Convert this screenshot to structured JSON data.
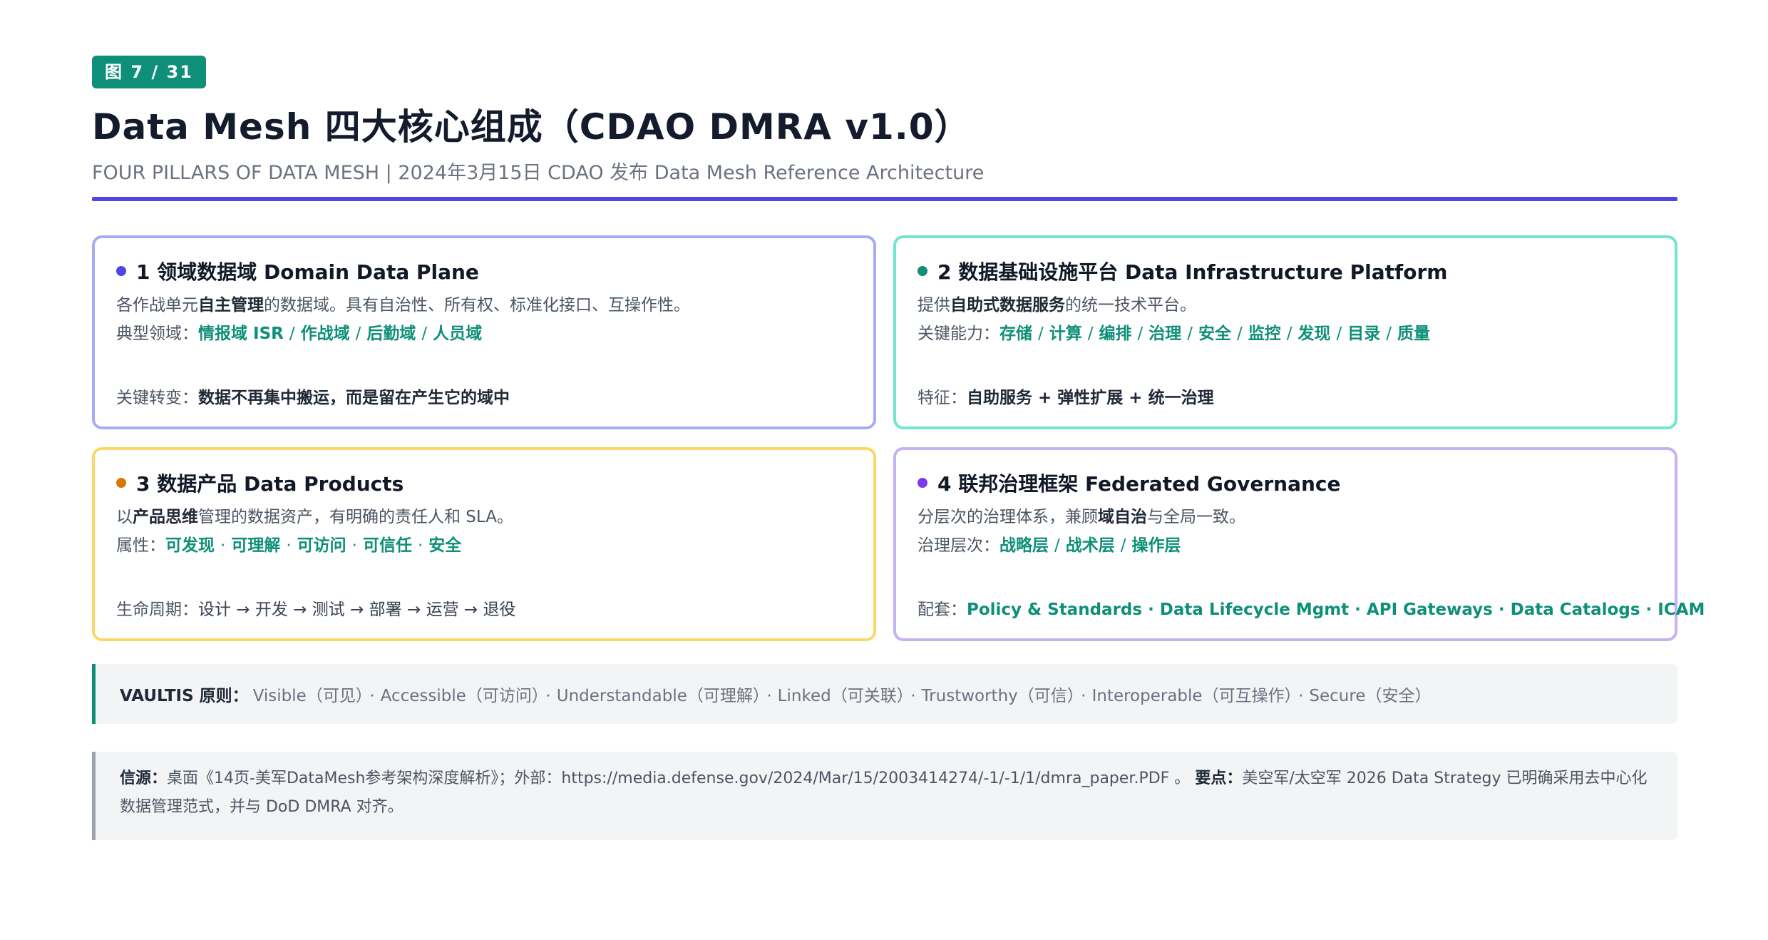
{
  "header": {
    "badge": "图 7 / 31",
    "title": "Data Mesh 四大核心组成（CDAO DMRA v1.0）",
    "subtitle": "FOUR PILLARS OF DATA MESH | 2024年3月15日 CDAO 发布 Data Mesh Reference Architecture"
  },
  "colors": {
    "accent": "#4f46e5",
    "teal": "#0e8f78",
    "card1_border": "#a5acf3",
    "card2_border": "#72e4d2",
    "card3_border": "#fbd76a",
    "card4_border": "#c6b2f2"
  },
  "cards": [
    {
      "title": "1 领域数据域 Domain Data Plane",
      "dot_color": "#4f46e5",
      "desc_pre": "各作战单元",
      "desc_bold": "自主管理",
      "desc_post": "的数据域。具有自治性、所有权、标准化接口、互操作性。",
      "meta_label": "典型领域：",
      "meta_items": [
        "情报域 ISR",
        "作战域",
        "后勤域",
        "人员域"
      ],
      "meta_sep": "/",
      "key_label": "关键转变：",
      "key_value": "数据不再集中搬运，而是留在产生它的域中"
    },
    {
      "title": "2 数据基础设施平台 Data Infrastructure Platform",
      "dot_color": "#0e8f78",
      "desc_pre": "提供",
      "desc_bold": "自助式数据服务",
      "desc_post": "的统一技术平台。",
      "meta_label": "关键能力：",
      "meta_items": [
        "存储",
        "计算",
        "编排",
        "治理",
        "安全",
        "监控",
        "发现",
        "目录",
        "质量"
      ],
      "meta_sep": "/",
      "key_label": "特征：",
      "key_value": "自助服务 + 弹性扩展 + 统一治理"
    },
    {
      "title": "3 数据产品 Data Products",
      "dot_color": "#d97706",
      "desc_pre": "以",
      "desc_bold": "产品思维",
      "desc_post": "管理的数据资产，有明确的责任人和 SLA。",
      "meta_label": "属性：",
      "meta_items": [
        "可发现",
        "可理解",
        "可访问",
        "可信任",
        "安全"
      ],
      "meta_sep": "·",
      "key_label": "生命周期：",
      "key_value": "设计 → 开发 → 测试 → 部署 → 运营 → 退役"
    },
    {
      "title": "4 联邦治理框架 Federated Governance",
      "dot_color": "#7c3aed",
      "desc_pre": "分层次的治理体系，兼顾",
      "desc_bold": "域自治",
      "desc_post": "与全局一致。",
      "meta_label": "治理层次：",
      "meta_items": [
        "战略层",
        "战术层",
        "操作层"
      ],
      "meta_sep": "/",
      "key_label": "配套：",
      "key_value": "Policy & Standards · Data Lifecycle Mgmt · API Gateways · Data Catalogs · ICAM"
    }
  ],
  "vaultis": {
    "label": "VAULTIS 原则：",
    "items": [
      "Visible（可见）",
      "Accessible（可访问）",
      "Understandable（可理解）",
      "Linked（可关联）",
      "Trustworthy（可信）",
      "Interoperable（可互操作）",
      "Secure（安全）"
    ],
    "sep": "·"
  },
  "source": {
    "label": "信源：",
    "text": "桌面《14页-美军DataMesh参考架构深度解析》；外部：https://media.defense.gov/2024/Mar/15/2003414274/-1/-1/1/dmra_paper.PDF 。",
    "point_label": "要点：",
    "point_text": "美空军/太空军 2026 Data Strategy 已明确采用去中心化数据管理范式，并与 DoD DMRA 对齐。"
  }
}
